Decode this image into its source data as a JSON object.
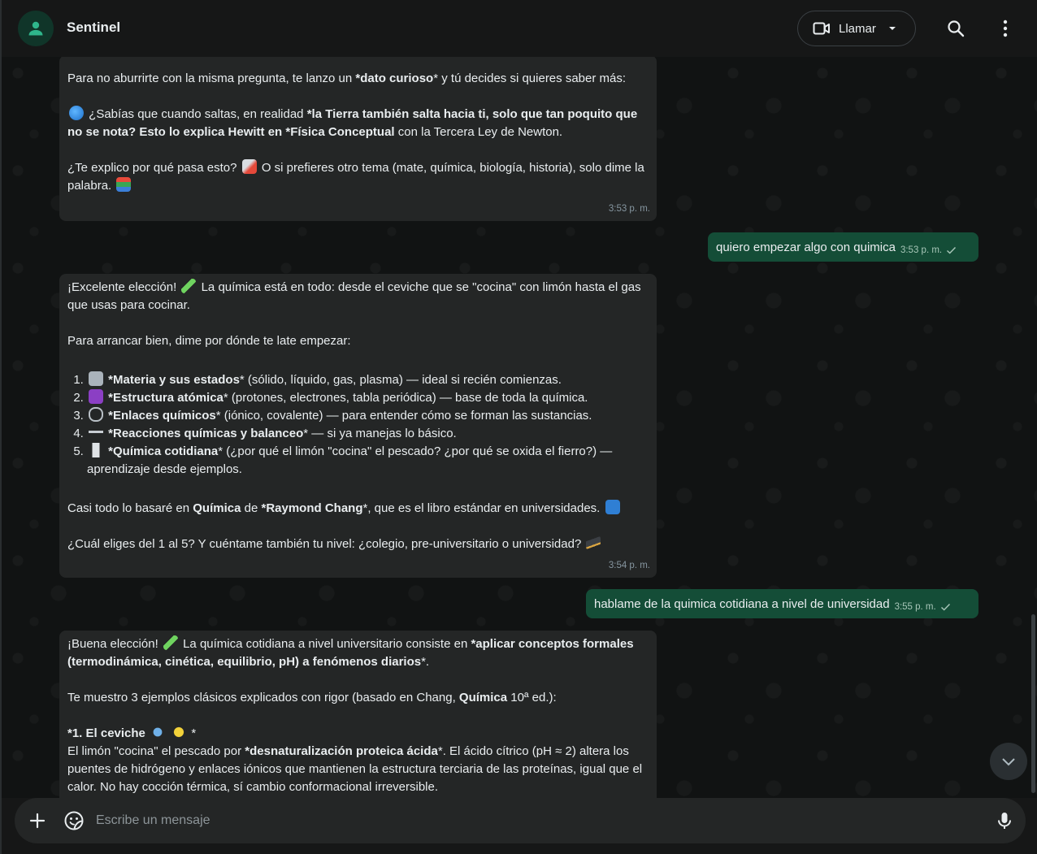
{
  "header": {
    "title": "Sentinel",
    "call_label": "Llamar",
    "icons": [
      "person-icon",
      "video-icon",
      "chevron-down-icon",
      "search-icon",
      "more-vertical-icon"
    ]
  },
  "messages": [
    {
      "side": "in",
      "p1": {
        "t1": "Para no aburrirte con la misma pregunta, te lanzo un ",
        "b1": "*dato curioso",
        "t2": "* y tú decides si quieres saber más:"
      },
      "p2": {
        "t1": "¿Sabías que cuando saltas, en realidad ",
        "b1": "*la Tierra también salta hacia ti, solo que tan poquito que no se nota? Esto lo explica Hewitt en *Física Conceptual",
        "t2": " con la Tercera Ley de Newton."
      },
      "p3": {
        "t1": "¿Te explico por qué pasa esto?",
        "t2": " O si prefieres otro tema (mate, química, biología, historia), solo dime la palabra."
      },
      "time": "3:53 p. m."
    },
    {
      "side": "out",
      "text": "quiero empezar algo con quimica",
      "time": "3:53 p. m."
    },
    {
      "side": "in",
      "p1": {
        "t1": "¡Excelente elección!",
        "t2": " La química está en todo: desde el ceviche que se \"cocina\" con limón hasta el gas que usas para cocinar."
      },
      "p2": "Para arrancar bien, dime por dónde te late empezar:",
      "list": [
        {
          "b": "*Materia y sus estados",
          "t": "* (sólido, líquido, gas, plasma) — ideal si recién comienzas."
        },
        {
          "b": "*Estructura atómica",
          "t": "* (protones, electrones, tabla periódica) — base de toda la química."
        },
        {
          "b": "*Enlaces químicos",
          "t": "* (iónico, covalente) — para entender cómo se forman las sustancias."
        },
        {
          "b": "*Reacciones químicas y balanceo",
          "t": "* — si ya manejas lo básico."
        },
        {
          "b": "*Química cotidiana",
          "t": "* (¿por qué el limón \"cocina\" el pescado? ¿por qué se oxida el fierro?) — aprendizaje desde ejemplos."
        }
      ],
      "p3": {
        "t1": "Casi todo lo basaré en ",
        "b1": "Química",
        "t2": " de ",
        "b2": "*Raymond Chang",
        "t3": "*, que es el libro estándar en universidades."
      },
      "p4": "¿Cuál eliges del 1 al 5? Y cuéntame también tu nivel: ¿colegio, pre-universitario o universidad?",
      "time": "3:54 p. m."
    },
    {
      "side": "out",
      "text": "hablame de la quimica cotidiana a nivel de universidad",
      "time": "3:55 p. m."
    },
    {
      "side": "in",
      "p1": {
        "t1": "¡Buena elección!",
        "t2": " La química cotidiana a nivel universitario consiste en ",
        "b1": "*aplicar conceptos formales (termodinámica, cinética, equilibrio, pH) a fenómenos diarios",
        "t3": "*."
      },
      "p2": {
        "t1": "Te muestro 3 ejemplos clásicos explicados con rigor (basado en Chang, ",
        "b1": "Química",
        "t2": " 10ª ed.):"
      },
      "h1": {
        "b": "*1. El ceviche",
        "t": "*"
      },
      "p3": {
        "t1": "El limón \"cocina\" el pescado por ",
        "b1": "*desnaturalización proteica ácida",
        "t2": "*. El ácido cítrico (pH ≈ 2) altera los puentes de hidrógeno y enlaces iónicos que mantienen la estructura terciaria de las proteínas, igual que el calor. No hay cocción térmica, sí cambio conformacional irreversible."
      }
    }
  ],
  "composer": {
    "placeholder": "Escribe un mensaje"
  },
  "colors": {
    "incoming": "#242626",
    "outgoing": "#144d37",
    "background": "#111313"
  }
}
